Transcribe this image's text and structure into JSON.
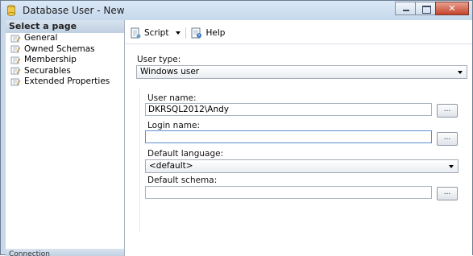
{
  "window": {
    "title": "Database User - New"
  },
  "left_pane": {
    "header": "Select a page",
    "items": [
      {
        "label": "General",
        "icon": "page-wrench-icon"
      },
      {
        "label": "Owned Schemas",
        "icon": "page-wrench-icon"
      },
      {
        "label": "Membership",
        "icon": "page-wrench-icon"
      },
      {
        "label": "Securables",
        "icon": "page-wrench-icon"
      },
      {
        "label": "Extended Properties",
        "icon": "page-wrench-icon"
      }
    ],
    "footer": "Connection"
  },
  "toolbar": {
    "script_label": "Script",
    "help_label": "Help"
  },
  "form": {
    "user_type_label": "User type:",
    "user_type_value": "Windows user",
    "user_name_label": "User name:",
    "user_name_value": "DKRSQL2012\\Andy",
    "login_name_label": "Login name:",
    "login_name_value": "",
    "default_language_label": "Default language:",
    "default_language_value": "<default>",
    "default_schema_label": "Default schema:",
    "default_schema_value": "",
    "browse_label": "..."
  },
  "colors": {
    "accent": "#5b8fd0",
    "close_button": "#c4442c"
  }
}
